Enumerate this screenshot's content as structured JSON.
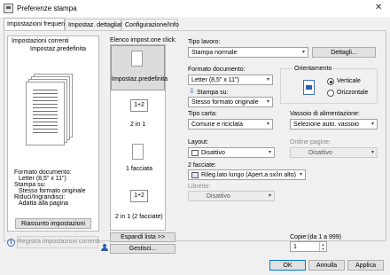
{
  "window": {
    "title": "Preferenze stampa",
    "close_glyph": "✕"
  },
  "tabs": [
    "Impostazioni frequenti",
    "Impostaz. dettagliate",
    "Configurazione/Info"
  ],
  "current": {
    "heading": "Impostazioni correnti",
    "preset_name": "Impostaz.predefinita",
    "summary": [
      "Formato documento:",
      "Letter (8,5\" x 11\")",
      "Stampa su:",
      "Stesso formato originale",
      "Riduci/Ingrandisci:",
      "Adatta alla pagina"
    ],
    "reset_button": "Riassunto impostazioni",
    "register_button": "Registra impostazioni correnti..."
  },
  "oneclick": {
    "heading": "Elenco impost.one click:",
    "items": [
      "Impostaz.predefinita",
      "2 in 1",
      "1 facciata",
      "2 in 1 (2 facciate)"
    ],
    "expand_button": "Espandi lista >>",
    "manage_button": "Gestisci..."
  },
  "job": {
    "type_label": "Tipo lavoro:",
    "type_value": "Stampa normale",
    "details_button": "Dettagli..."
  },
  "document": {
    "size_label": "Formato documento:",
    "size_value": "Letter (8,5\" x 11\")",
    "printon_label": "Stampa su:",
    "printon_value": "Stesso formato originale"
  },
  "orientation": {
    "label": "Orientamento",
    "portrait": "Verticale",
    "landscape": "Orizzontale",
    "selected": "portrait"
  },
  "paper": {
    "type_label": "Tipo carta:",
    "type_value": "Comune e riciclata",
    "tray_label": "Vassoio di alimentazione:",
    "tray_value": "Selezione auto. vassoio"
  },
  "layout": {
    "label": "Layout:",
    "value": "Disattivo",
    "order_label": "Ordine pagine:",
    "order_value": "Disattivo"
  },
  "duplex": {
    "label": "2 facciate:",
    "value": "Rileg.lato lungo (Apert.a sx/in alto)"
  },
  "booklet": {
    "label": "Libretto:",
    "value": "Disattivo"
  },
  "copies": {
    "label": "Copie:(da 1 a 999)",
    "value": "1"
  },
  "footer": {
    "ok": "OK",
    "cancel": "Annulla",
    "apply": "Applica"
  },
  "icons": {
    "info": "i"
  }
}
